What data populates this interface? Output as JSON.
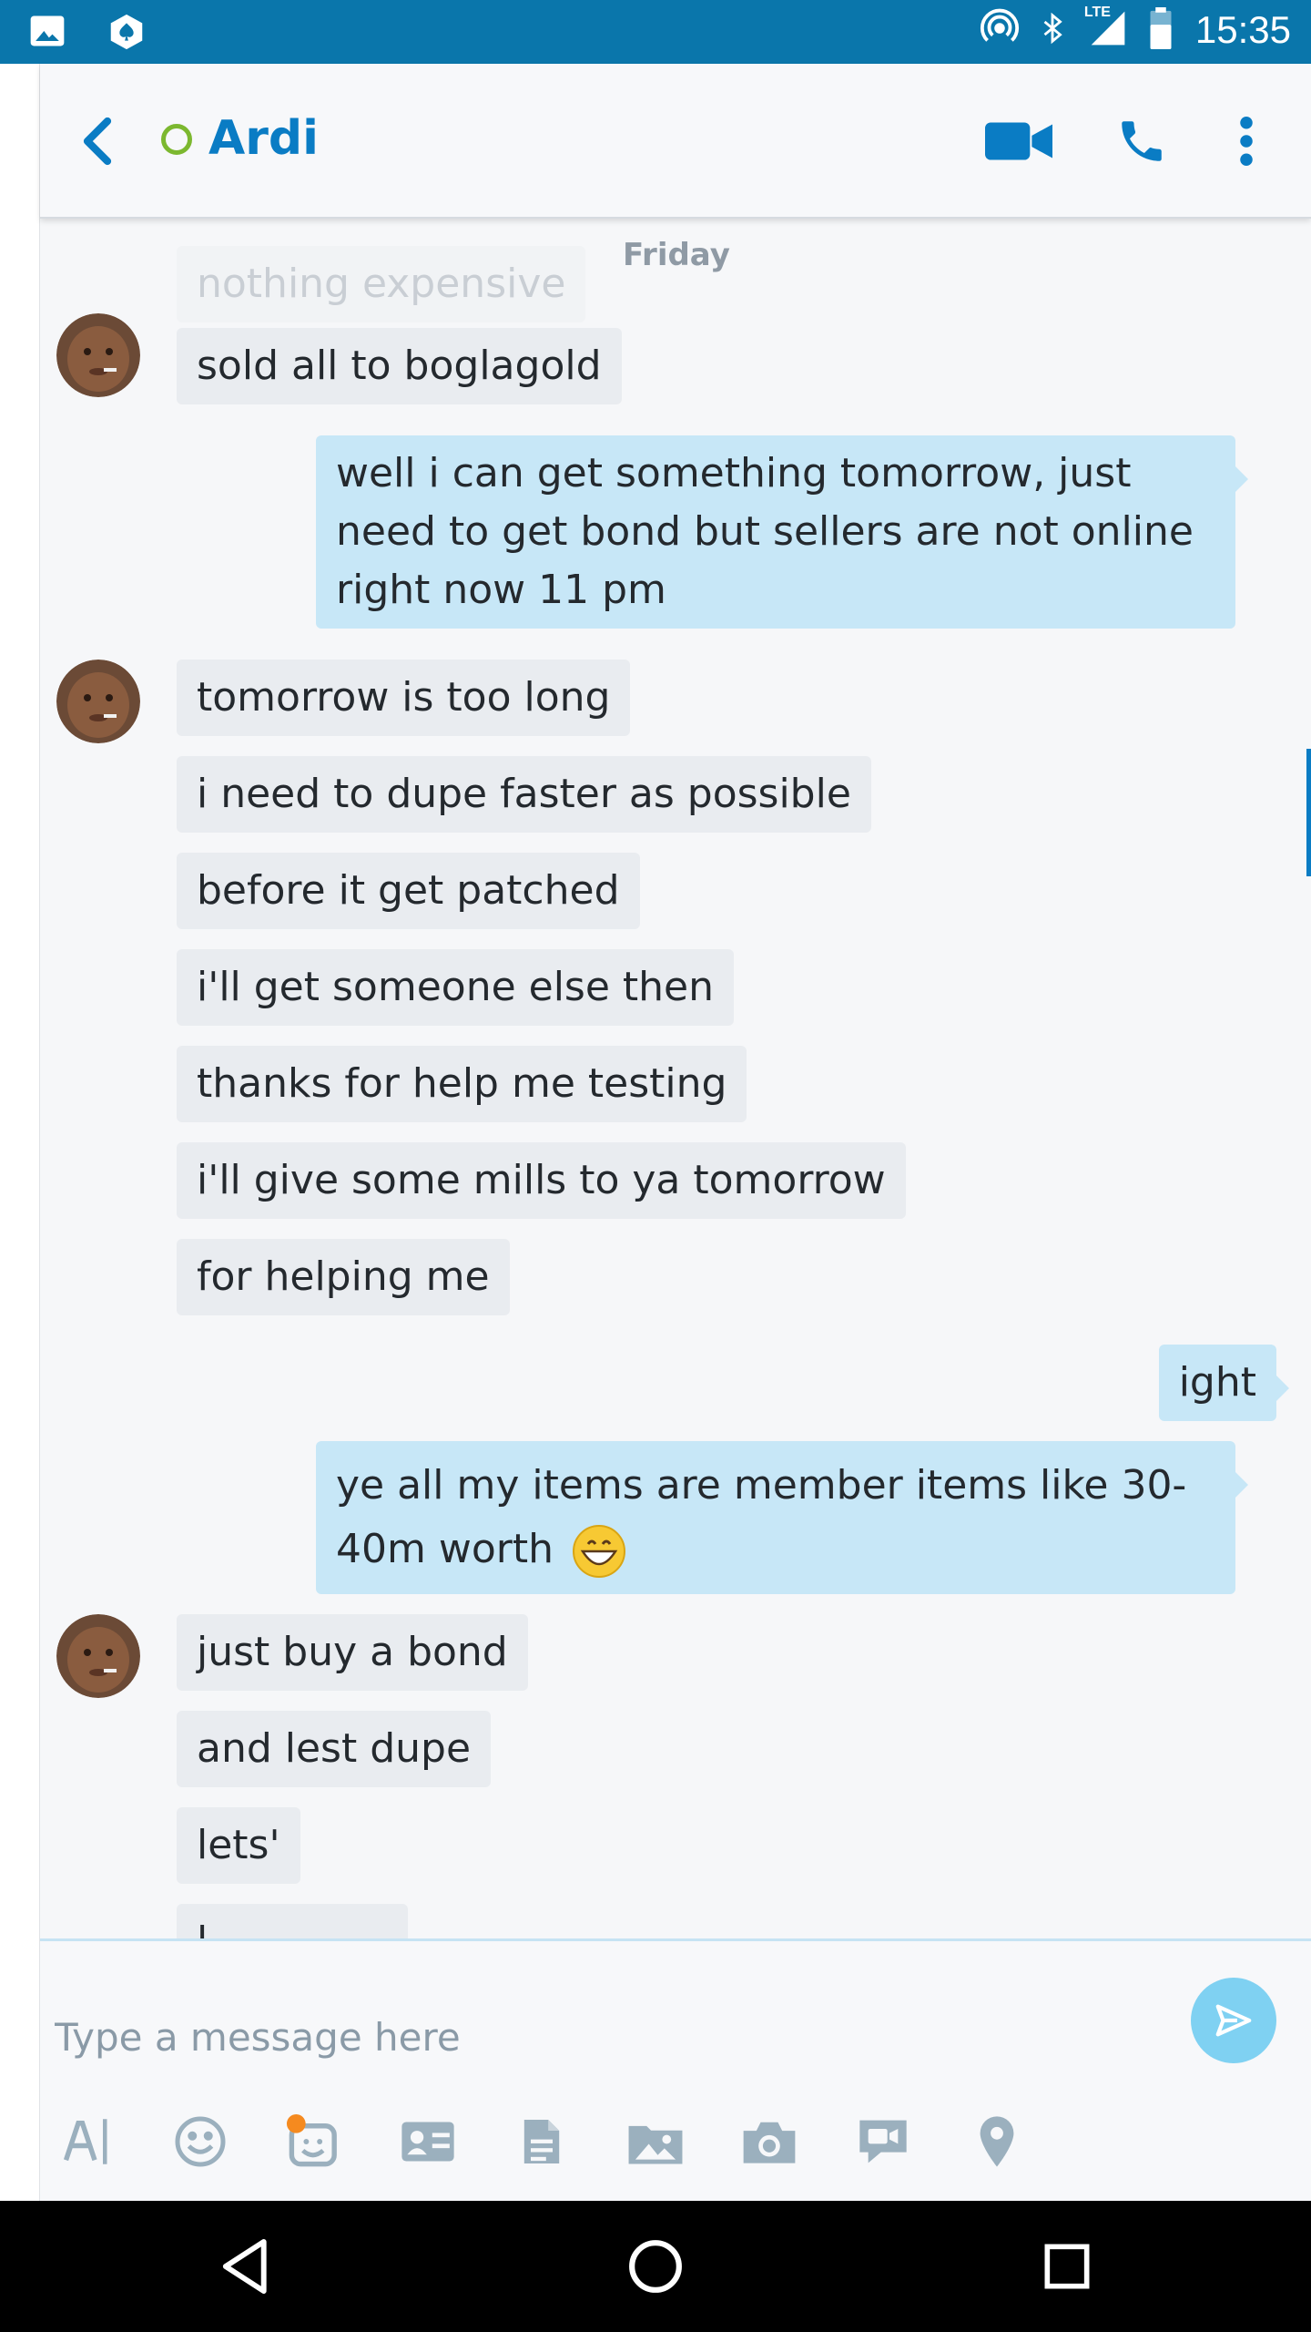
{
  "status_bar": {
    "time": "15:35",
    "network": "LTE",
    "icons": [
      "gallery-icon",
      "poker-app-icon",
      "hotspot-icon",
      "bluetooth-icon",
      "signal-icon",
      "battery-icon"
    ]
  },
  "header": {
    "contact_name": "Ardi",
    "presence": "offline",
    "icons": [
      "back-icon",
      "video-call-icon",
      "phone-icon",
      "more-vert-icon"
    ]
  },
  "chat": {
    "day_label": "Friday",
    "messages": [
      {
        "from": "them",
        "text": "nothing expensive"
      },
      {
        "from": "them",
        "text": "sold all to boglagold"
      },
      {
        "from": "me",
        "text": "well i can get something tomorrow, just need to get bond but sellers are not online right now 11 pm"
      },
      {
        "from": "them",
        "text": "tomorrow is too long"
      },
      {
        "from": "them",
        "text": "i need to dupe faster as possible"
      },
      {
        "from": "them",
        "text": "before it get patched"
      },
      {
        "from": "them",
        "text": "i'll get someone else then"
      },
      {
        "from": "them",
        "text": "thanks for help me testing"
      },
      {
        "from": "them",
        "text": "i'll give some mills to ya tomorrow"
      },
      {
        "from": "them",
        "text": "for helping me"
      },
      {
        "from": "me",
        "text": "ight"
      },
      {
        "from": "me",
        "text": "ye all my items are member items like 30-40m worth",
        "emoji": "grinning-face-icon"
      },
      {
        "from": "them",
        "text": "just buy a bond"
      },
      {
        "from": "them",
        "text": "and lest dupe"
      },
      {
        "from": "them",
        "text": "lets'"
      },
      {
        "from": "them",
        "text": "l"
      }
    ]
  },
  "compose": {
    "placeholder": "Type a message here",
    "toolbar_icons": [
      "text-format-icon",
      "emoticon-icon",
      "mojis-icon",
      "contact-card-icon",
      "file-icon",
      "media-album-icon",
      "camera-icon",
      "video-message-icon",
      "location-icon"
    ]
  },
  "colors": {
    "status_bar": "#0a76ab",
    "accent": "#0a7cc4",
    "outgoing_bubble": "#c7e7f7",
    "incoming_bubble": "#e9ecf0",
    "presence_ring": "#7cb82f",
    "send_button": "#7fd1f2"
  },
  "nav_bar": {
    "icons": [
      "nav-back-icon",
      "nav-home-icon",
      "nav-recents-icon"
    ]
  }
}
